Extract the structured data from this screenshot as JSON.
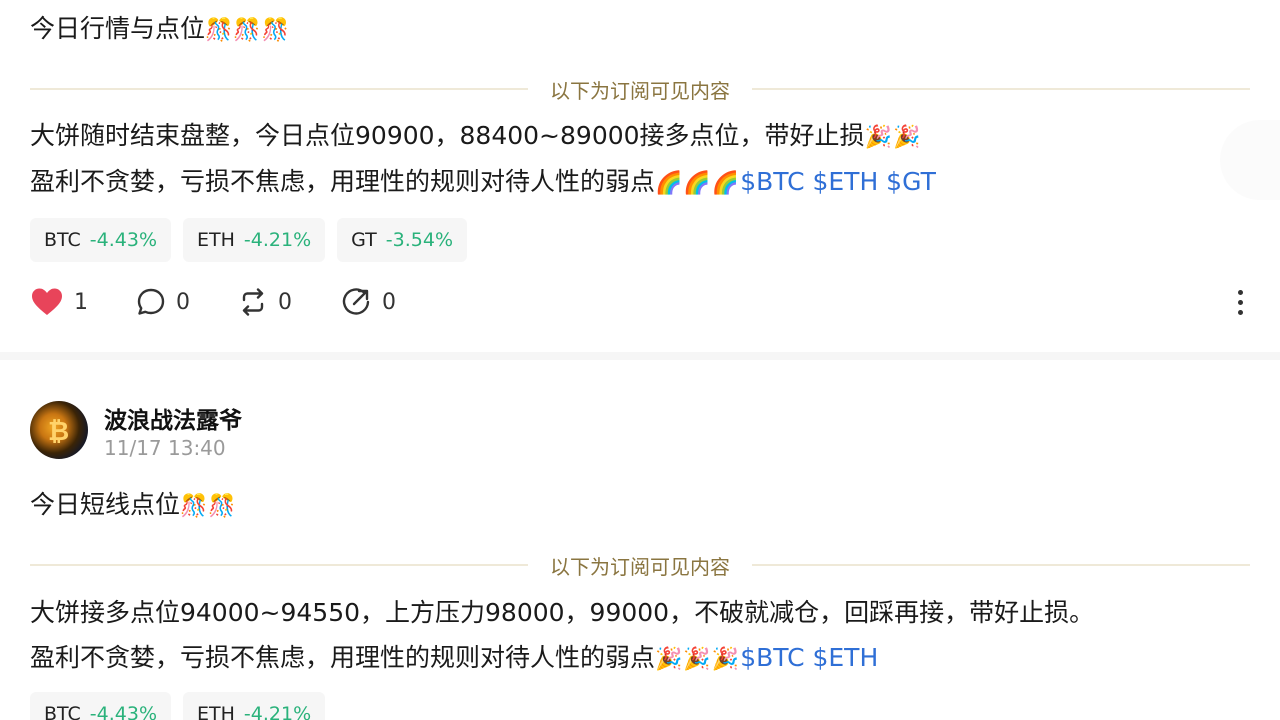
{
  "posts": [
    {
      "title": "今日行情与点位",
      "title_emoji": "🎊🎊🎊",
      "divider_label": "以下为订阅可见内容",
      "line1": "大饼随时结束盘整，今日点位90900，88400~89000接多点位，带好止损",
      "line1_emoji": "🎉🎉",
      "line2": "盈利不贪婪，亏损不焦虑，用理性的规则对待人性的弱点",
      "line2_emoji": "🌈🌈🌈",
      "tickers": "$BTC $ETH $GT",
      "chips": [
        {
          "symbol": "BTC",
          "change": "-4.43%"
        },
        {
          "symbol": "ETH",
          "change": "-4.21%"
        },
        {
          "symbol": "GT",
          "change": "-3.54%"
        }
      ],
      "actions": {
        "likes": "1",
        "comments": "0",
        "reposts": "0",
        "shares": "0"
      }
    },
    {
      "author": "波浪战法露爷",
      "time": "11/17 13:40",
      "title": "今日短线点位",
      "title_emoji": "🎊🎊",
      "divider_label": "以下为订阅可见内容",
      "line1": "大饼接多点位94000~94550，上方压力98000，99000，不破就减仓，回踩再接，带好止损。",
      "line2": "盈利不贪婪，亏损不焦虑，用理性的规则对待人性的弱点",
      "line2_emoji": "🎉🎉🎉",
      "tickers": "$BTC $ETH",
      "chips": [
        {
          "symbol": "BTC",
          "change": "-4.43%"
        },
        {
          "symbol": "ETH",
          "change": "-4.21%"
        }
      ]
    }
  ],
  "colors": {
    "positive_change": "#2ab27b",
    "ticker_link": "#2f6fd6",
    "like": "#e8445a"
  }
}
